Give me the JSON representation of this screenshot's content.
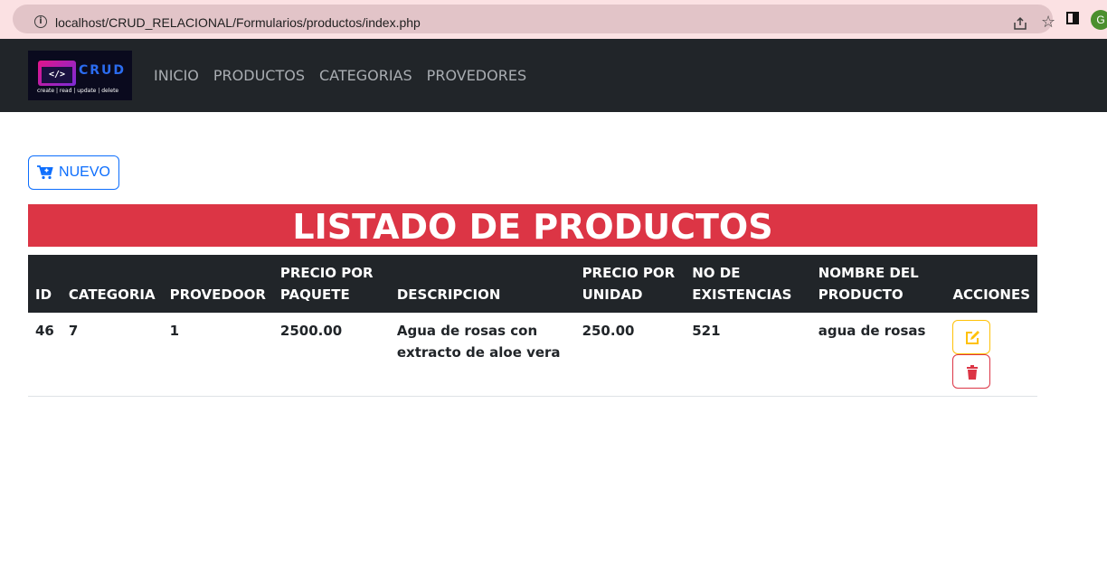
{
  "browser": {
    "url": "localhost/CRUD_RELACIONAL/Formularios/productos/index.php",
    "avatar_letter": "G"
  },
  "logo": {
    "title": "CRUD",
    "code": "</>",
    "tagline": "create | read | update | delete"
  },
  "nav": {
    "items": [
      {
        "label": "INICIO"
      },
      {
        "label": "PRODUCTOS"
      },
      {
        "label": "CATEGORIAS"
      },
      {
        "label": "PROVEDORES"
      }
    ]
  },
  "actions": {
    "new_label": "NUEVO"
  },
  "page": {
    "title": "LISTADO DE PRODUCTOS"
  },
  "table": {
    "headers": [
      "ID",
      "CATEGORIA",
      "PROVEDOOR",
      "PRECIO POR PAQUETE",
      "DESCRIPCION",
      "PRECIO POR UNIDAD",
      "NO DE EXISTENCIAS",
      "NOMBRE DEL PRODUCTO",
      "ACCIONES"
    ],
    "rows": [
      {
        "id": "46",
        "categoria": "7",
        "provedor": "1",
        "precio_paquete": "2500.00",
        "descripcion": "Agua de rosas con extracto de aloe vera",
        "precio_unidad": "250.00",
        "existencias": "521",
        "nombre": "agua de rosas"
      }
    ]
  },
  "colors": {
    "navbar": "#212529",
    "primary": "#0d6efd",
    "danger": "#dc3545",
    "warning": "#ffc107"
  },
  "icons": {
    "new": "cart-plus-icon",
    "edit": "edit-icon",
    "delete": "trash-icon"
  }
}
